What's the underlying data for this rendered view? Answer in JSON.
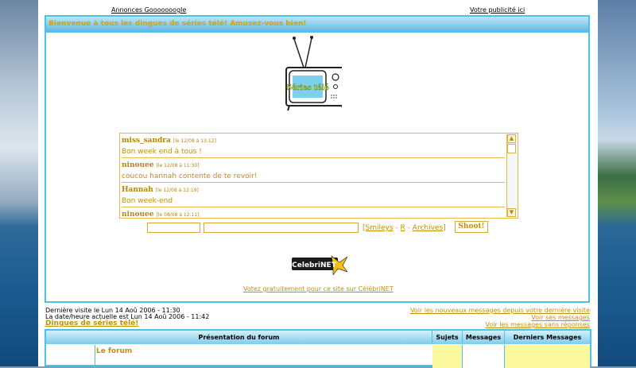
{
  "top_ads": {
    "left": "Annonces Gooooooogle",
    "right": "Votre publicité ici"
  },
  "welcome": "Bienvenue à tous les dingues de séries télé! Amusez-vous bien!",
  "tv_screen_text": "Séries télé",
  "chat": {
    "messages": [
      {
        "user": "miss_sandra",
        "date": "[le 12/08 à 13:12]",
        "text": "Bon week end à tous !"
      },
      {
        "user": "ninouee",
        "date": "[le 12/08 à 11:30]",
        "text": "coucou hannah contente de te revoir!"
      },
      {
        "user": "Hannah",
        "date": "[le 12/08 à 12:19]",
        "text": "Bon week-end"
      },
      {
        "user": "ninouee",
        "date": "[le 08/08 à 12:11]",
        "text": ""
      }
    ],
    "links": {
      "smileys": "Smileys",
      "r": "R",
      "archives": "Archives"
    },
    "shoot": "Shoot!"
  },
  "celebrinet": {
    "logo_text": "CelebriNET",
    "vote_link": "Votez gratuitement pour ce site sur CélébriNET"
  },
  "info": {
    "last_visit": "Dernière visite le Lun 14 Aoû 2006 - 11:30",
    "current": "La date/heure actuelle est Lun 14 Aoû 2006 - 11:42",
    "forum_name": "Dingues de séries télé!",
    "new_since": "Voir les nouveaux messages depuis votre dernière visite",
    "your_msgs": "Voir ses messages",
    "no_reply": "Voir les messages sans réponses"
  },
  "table": {
    "headers": [
      "Présentation du forum",
      "Sujets",
      "Messages",
      "Derniers Messages"
    ],
    "category": "Le forum"
  }
}
